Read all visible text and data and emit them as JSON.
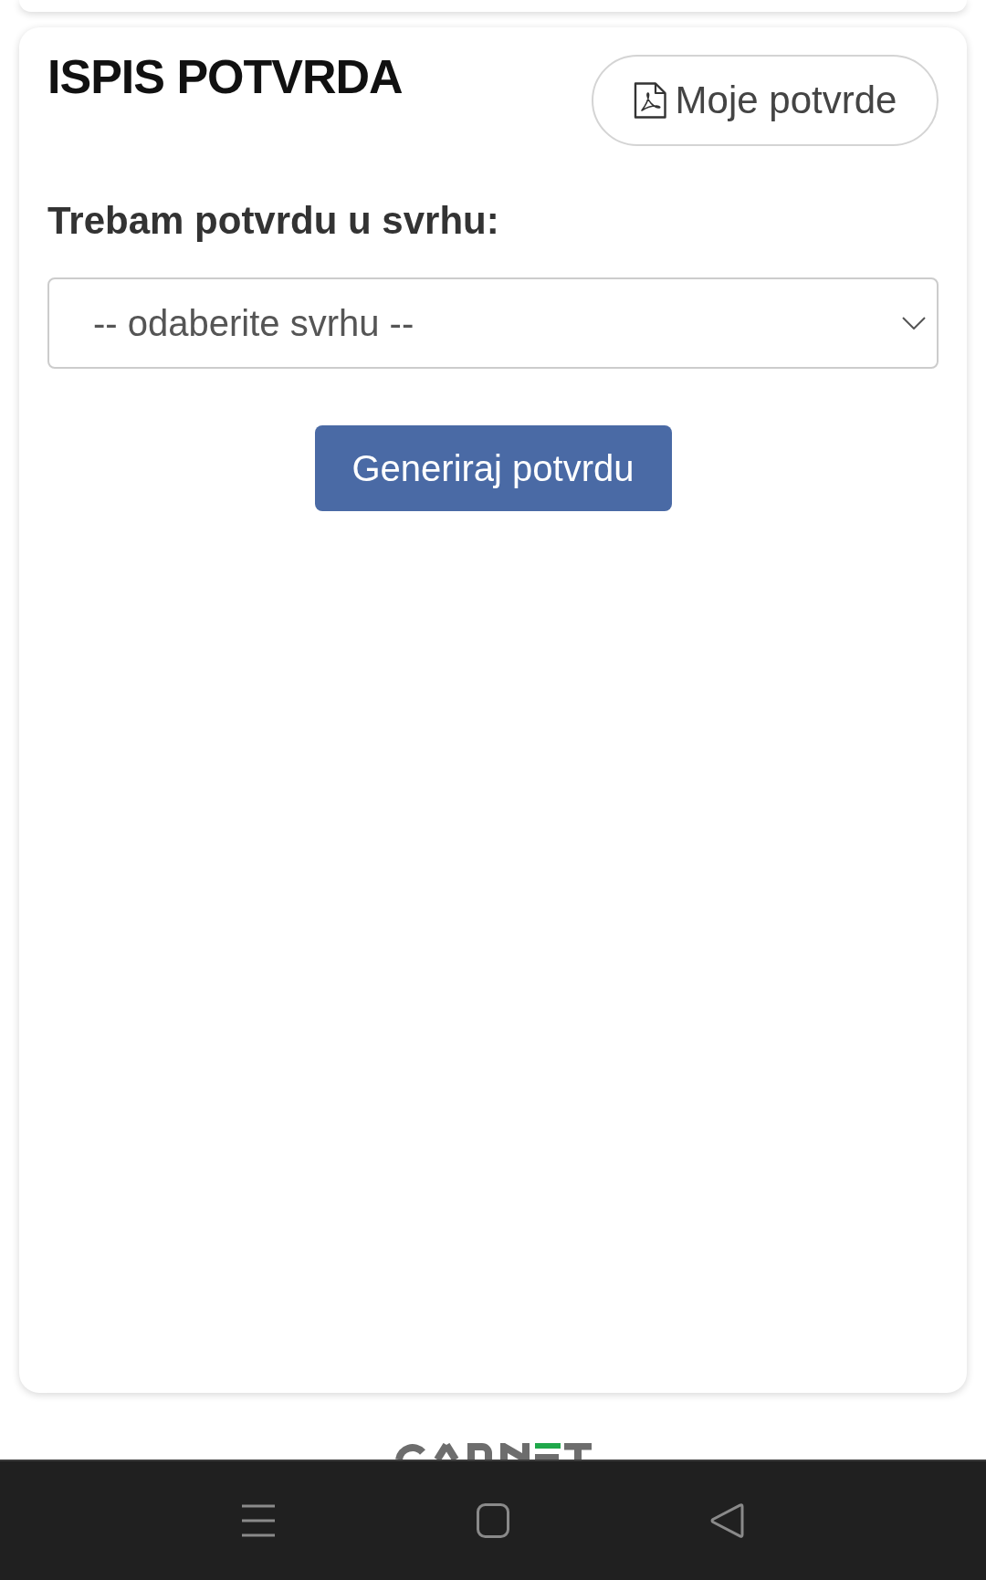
{
  "page_title": "ISPIS POTVRDA",
  "my_certificates_button": {
    "label": "Moje potvrde"
  },
  "purpose_field": {
    "label": "Trebam potvrdu u svrhu:",
    "value": "-- odaberite svrhu --"
  },
  "generate_button": {
    "label": "Generiraj potvrdu"
  },
  "nav_bar": {
    "buttons": [
      {
        "kind": "menu"
      },
      {
        "kind": "home"
      },
      {
        "kind": "back"
      }
    ]
  }
}
